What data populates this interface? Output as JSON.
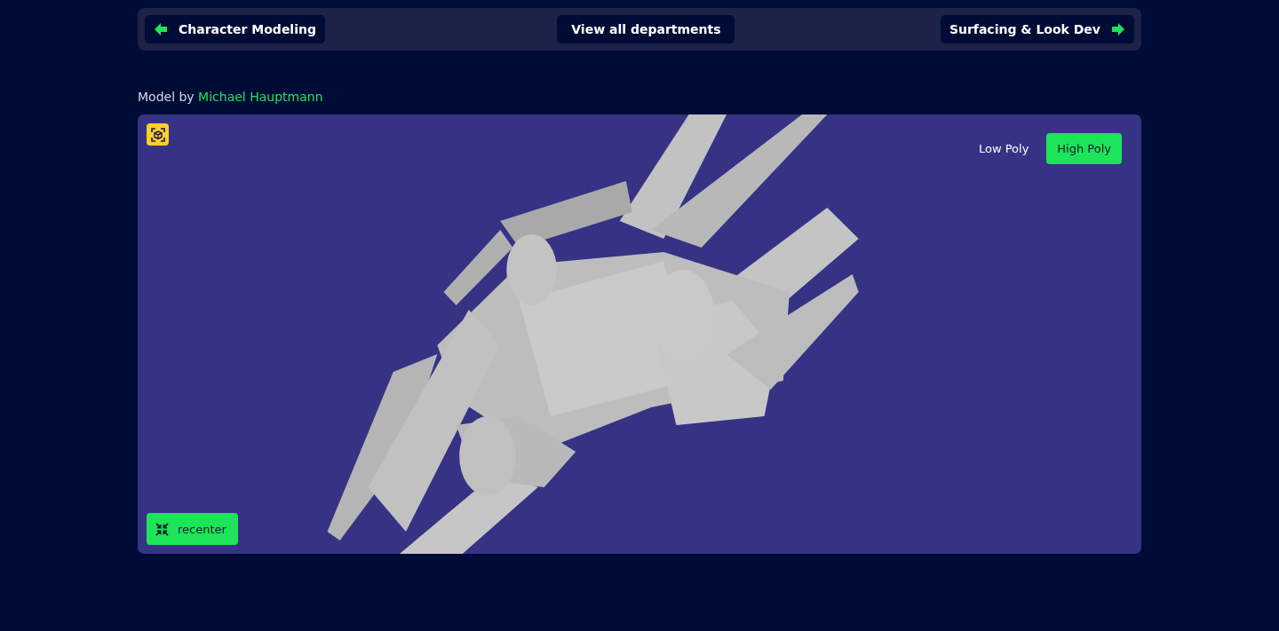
{
  "nav": {
    "previous": "Character Modeling",
    "all": "View all departments",
    "next": "Surfacing & Look Dev"
  },
  "credit": {
    "prefix": "Model by",
    "author": "Michael Hauptmann"
  },
  "viewer": {
    "modes": [
      {
        "label": "Low Poly",
        "selected": false
      },
      {
        "label": "High Poly",
        "selected": true
      }
    ],
    "recenter": "recenter"
  }
}
